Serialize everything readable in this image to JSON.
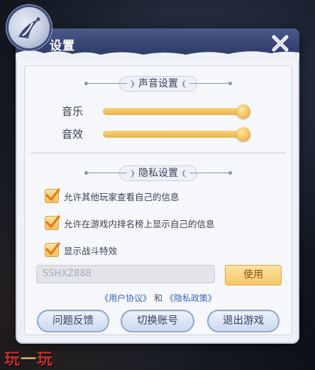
{
  "header": {
    "title": "设置",
    "close_icon": "close-x-icon"
  },
  "sound_section": {
    "title": "声音设置",
    "sliders": [
      {
        "label": "音乐",
        "value": 1.0
      },
      {
        "label": "音效",
        "value": 1.0
      }
    ]
  },
  "privacy_section": {
    "title": "隐私设置",
    "options": [
      {
        "label": "允许其他玩家查看自己的信息",
        "checked": true
      },
      {
        "label": "允许在游戏内排名榜上显示自己的信息",
        "checked": true
      },
      {
        "label": "显示战斗特效",
        "checked": true
      }
    ]
  },
  "redeem": {
    "input_value": "SSHXZ888",
    "button_label": "使用"
  },
  "links": {
    "user_agreement": "《用户协议》",
    "and": "和",
    "privacy_policy": "《隐私政策》"
  },
  "buttons": {
    "feedback": "问题反馈",
    "switch_account": "切换账号",
    "quit_game": "退出游戏"
  },
  "watermark": {
    "text_left": "玩",
    "text_dash": "一",
    "text_right": "玩"
  },
  "colors": {
    "accent_gold": "#f0c05f",
    "header_blue": "#364373",
    "link_blue": "#3d63b7"
  }
}
